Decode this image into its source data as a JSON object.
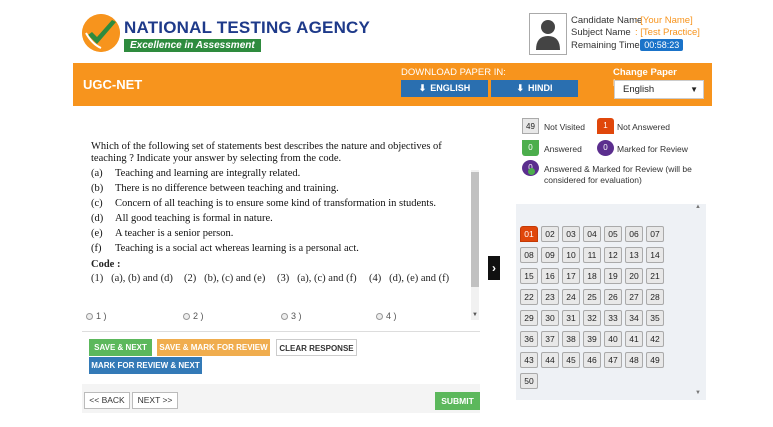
{
  "header": {
    "agency_name": "NATIONAL TESTING AGENCY",
    "tagline": "Excellence in Assessment",
    "logo_icon": "nta-logo-icon"
  },
  "candidate": {
    "name_label": "Candidate Name",
    "name_value": ": [Your Name]",
    "subject_label": "Subject Name",
    "subject_value": ": [Test Practice]",
    "time_label": "Remaining Time",
    "time_sep": ":",
    "time_value": "00:58:23",
    "photo_icon": "user-avatar-icon"
  },
  "topbar": {
    "exam_name": "UGC-NET",
    "download_label": "DOWNLOAD PAPER IN:",
    "english_label": "ENGLISH",
    "hindi_label": "HINDI",
    "language_label": "Change Paper Language :",
    "language_value": "English"
  },
  "question": {
    "text": "Which of the following set of statements best describes the nature and objectives of teaching ? Indicate your answer by selecting from the code.",
    "statements": [
      {
        "key": "(a)",
        "text": "Teaching and learning are integrally related."
      },
      {
        "key": "(b)",
        "text": "There is no difference between teaching and training."
      },
      {
        "key": "(c)",
        "text": "Concern of all teaching is to ensure some kind of transformation in students."
      },
      {
        "key": "(d)",
        "text": "All good teaching is formal in nature."
      },
      {
        "key": "(e)",
        "text": "A teacher is a senior person."
      },
      {
        "key": "(f)",
        "text": "Teaching is a social act whereas learning is a personal act."
      }
    ],
    "code_label": "Code :",
    "codes": [
      {
        "num": "(1)",
        "text": "(a), (b) and (d)"
      },
      {
        "num": "(2)",
        "text": "(b), (c) and (e)"
      },
      {
        "num": "(3)",
        "text": "(a), (c) and (f)"
      },
      {
        "num": "(4)",
        "text": "(d), (e) and (f)"
      }
    ],
    "options": [
      "1 )",
      "2 )",
      "3 )",
      "4 )"
    ]
  },
  "actions": {
    "save_next": "SAVE & NEXT",
    "save_mark": "SAVE & MARK FOR REVIEW",
    "clear": "CLEAR RESPONSE",
    "mark_next": "MARK FOR REVIEW & NEXT",
    "back": "<< BACK",
    "next": "NEXT >>",
    "submit": "SUBMIT"
  },
  "legend": {
    "not_visited_count": "49",
    "not_visited": "Not Visited",
    "not_answered_count": "1",
    "not_answered": "Not Answered",
    "answered_count": "0",
    "answered": "Answered",
    "marked_count": "0",
    "marked": "Marked for Review",
    "ans_marked_count": "0",
    "ans_marked": "Answered & Marked for Review (will be considered for evaluation)"
  },
  "palette": {
    "current": "01",
    "questions": [
      "01",
      "02",
      "03",
      "04",
      "05",
      "06",
      "07",
      "08",
      "09",
      "10",
      "11",
      "12",
      "13",
      "14",
      "15",
      "16",
      "17",
      "18",
      "19",
      "20",
      "21",
      "22",
      "23",
      "24",
      "25",
      "26",
      "27",
      "28",
      "29",
      "30",
      "31",
      "32",
      "33",
      "34",
      "35",
      "36",
      "37",
      "38",
      "39",
      "40",
      "41",
      "42",
      "43",
      "44",
      "45",
      "46",
      "47",
      "48",
      "49",
      "50"
    ]
  },
  "colors": {
    "brand_orange": "#f7941d",
    "brand_blue": "#1e3a8a",
    "not_answered": "#e0470b",
    "answered": "#4cae4c",
    "marked": "#5b2e8e"
  }
}
